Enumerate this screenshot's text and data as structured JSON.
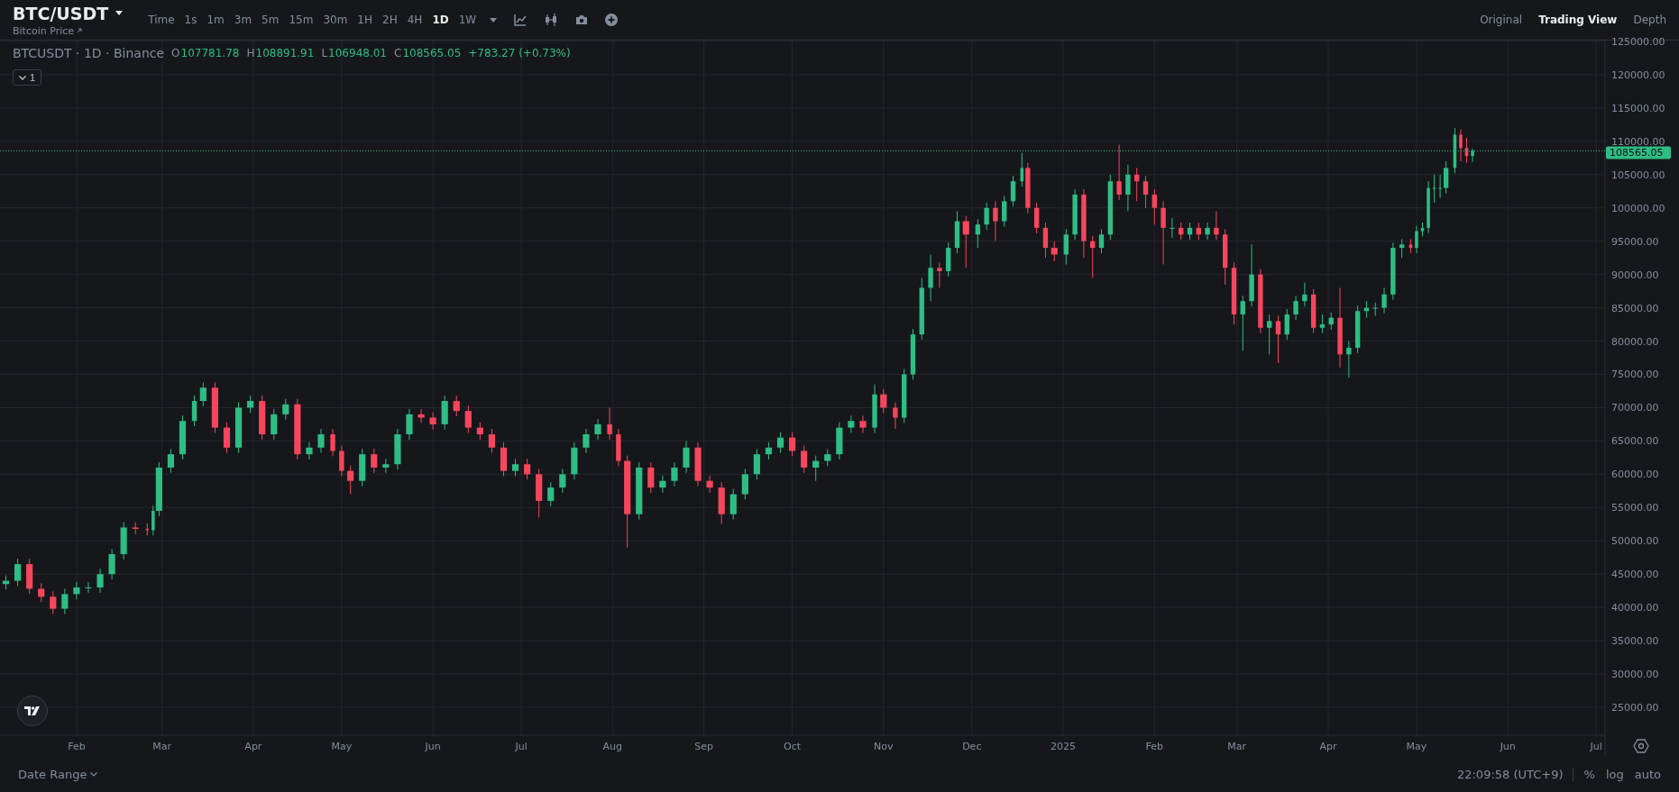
{
  "header": {
    "title": "BTC/USDT",
    "subtitle": "Bitcoin Price",
    "intervals": [
      {
        "label": "Time",
        "selected": false
      },
      {
        "label": "1s",
        "selected": false
      },
      {
        "label": "1m",
        "selected": false
      },
      {
        "label": "3m",
        "selected": false
      },
      {
        "label": "5m",
        "selected": false
      },
      {
        "label": "15m",
        "selected": false
      },
      {
        "label": "30m",
        "selected": false
      },
      {
        "label": "1H",
        "selected": false
      },
      {
        "label": "2H",
        "selected": false
      },
      {
        "label": "4H",
        "selected": false
      },
      {
        "label": "1D",
        "selected": true
      },
      {
        "label": "1W",
        "selected": false
      }
    ],
    "views": [
      {
        "label": "Original",
        "selected": false
      },
      {
        "label": "Trading View",
        "selected": true
      },
      {
        "label": "Depth",
        "selected": false
      }
    ]
  },
  "legend": {
    "symbol": "BTCUSDT · 1D · Binance",
    "ohlc": [
      {
        "label": "O",
        "value": "107781.78"
      },
      {
        "label": "H",
        "value": "108891.91"
      },
      {
        "label": "L",
        "value": "106948.01"
      },
      {
        "label": "C",
        "value": "108565.05"
      }
    ],
    "change": "+783.27 (+0.73%)",
    "collapse": "1"
  },
  "chart": {
    "last_price": "108565.05",
    "chart_data": {
      "type": "candlestick",
      "grid": true,
      "ref_lines": [
        {
          "axis": "y",
          "value": 108565,
          "color": "#2ebd85"
        }
      ],
      "xlim": [
        "2024-01-06",
        "2025-07-04"
      ],
      "ylim": [
        20800,
        125135
      ],
      "yticks": [
        {
          "value": 25000,
          "label": "25000.00"
        },
        {
          "value": 30000,
          "label": "30000.00"
        },
        {
          "value": 35000,
          "label": "35000.00"
        },
        {
          "value": 40000,
          "label": "40000.00"
        },
        {
          "value": 45000,
          "label": "45000.00"
        },
        {
          "value": 50000,
          "label": "50000.00"
        },
        {
          "value": 55000,
          "label": "55000.00"
        },
        {
          "value": 60000,
          "label": "60000.00"
        },
        {
          "value": 65000,
          "label": "65000.00"
        },
        {
          "value": 70000,
          "label": "70000.00"
        },
        {
          "value": 75000,
          "label": "75000.00"
        },
        {
          "value": 80000,
          "label": "80000.00"
        },
        {
          "value": 85000,
          "label": "85000.00"
        },
        {
          "value": 90000,
          "label": "90000.00"
        },
        {
          "value": 95000,
          "label": "95000.00"
        },
        {
          "value": 100000,
          "label": "100000.00"
        },
        {
          "value": 105000,
          "label": "105000.00"
        },
        {
          "value": 110000,
          "label": "110000.00"
        },
        {
          "value": 115000,
          "label": "115000.00"
        },
        {
          "value": 120000,
          "label": "120000.00"
        },
        {
          "value": 125000,
          "label": "125000.00"
        }
      ],
      "xticks": [
        {
          "value": "2024-02-01",
          "label": "Feb"
        },
        {
          "value": "2024-03-01",
          "label": "Mar"
        },
        {
          "value": "2024-04-01",
          "label": "Apr"
        },
        {
          "value": "2024-05-01",
          "label": "May"
        },
        {
          "value": "2024-06-01",
          "label": "Jun"
        },
        {
          "value": "2024-07-01",
          "label": "Jul"
        },
        {
          "value": "2024-08-01",
          "label": "Aug"
        },
        {
          "value": "2024-09-01",
          "label": "Sep"
        },
        {
          "value": "2024-10-01",
          "label": "Oct"
        },
        {
          "value": "2024-11-01",
          "label": "Nov"
        },
        {
          "value": "2024-12-01",
          "label": "Dec"
        },
        {
          "value": "2025-01-01",
          "label": "2025"
        },
        {
          "value": "2025-02-01",
          "label": "Feb"
        },
        {
          "value": "2025-03-01",
          "label": "Mar"
        },
        {
          "value": "2025-04-01",
          "label": "Apr"
        },
        {
          "value": "2025-05-01",
          "label": "May"
        },
        {
          "value": "2025-06-01",
          "label": "Jun"
        },
        {
          "value": "2025-07-01",
          "label": "Jul"
        }
      ],
      "x": [
        "2024-01-08",
        "2024-01-12",
        "2024-01-16",
        "2024-01-20",
        "2024-01-24",
        "2024-01-28",
        "2024-02-01",
        "2024-02-05",
        "2024-02-09",
        "2024-02-13",
        "2024-02-17",
        "2024-02-21",
        "2024-02-25",
        "2024-02-27",
        "2024-02-29",
        "2024-03-04",
        "2024-03-08",
        "2024-03-12",
        "2024-03-15",
        "2024-03-19",
        "2024-03-23",
        "2024-03-27",
        "2024-03-31",
        "2024-04-04",
        "2024-04-08",
        "2024-04-12",
        "2024-04-16",
        "2024-04-20",
        "2024-04-24",
        "2024-04-28",
        "2024-05-01",
        "2024-05-04",
        "2024-05-08",
        "2024-05-12",
        "2024-05-16",
        "2024-05-20",
        "2024-05-24",
        "2024-05-28",
        "2024-06-01",
        "2024-06-05",
        "2024-06-09",
        "2024-06-13",
        "2024-06-17",
        "2024-06-21",
        "2024-06-25",
        "2024-06-29",
        "2024-07-03",
        "2024-07-07",
        "2024-07-11",
        "2024-07-15",
        "2024-07-19",
        "2024-07-23",
        "2024-07-27",
        "2024-07-31",
        "2024-08-03",
        "2024-08-06",
        "2024-08-10",
        "2024-08-14",
        "2024-08-18",
        "2024-08-22",
        "2024-08-26",
        "2024-08-30",
        "2024-09-03",
        "2024-09-07",
        "2024-09-11",
        "2024-09-15",
        "2024-09-19",
        "2024-09-23",
        "2024-09-27",
        "2024-10-01",
        "2024-10-05",
        "2024-10-09",
        "2024-10-13",
        "2024-10-17",
        "2024-10-21",
        "2024-10-25",
        "2024-10-29",
        "2024-11-01",
        "2024-11-05",
        "2024-11-08",
        "2024-11-11",
        "2024-11-14",
        "2024-11-17",
        "2024-11-20",
        "2024-11-23",
        "2024-11-26",
        "2024-11-29",
        "2024-12-03",
        "2024-12-06",
        "2024-12-09",
        "2024-12-12",
        "2024-12-15",
        "2024-12-18",
        "2024-12-20",
        "2024-12-23",
        "2024-12-26",
        "2024-12-29",
        "2025-01-02",
        "2025-01-05",
        "2025-01-08",
        "2025-01-11",
        "2025-01-14",
        "2025-01-17",
        "2025-01-20",
        "2025-01-23",
        "2025-01-26",
        "2025-01-29",
        "2025-02-01",
        "2025-02-04",
        "2025-02-07",
        "2025-02-10",
        "2025-02-13",
        "2025-02-16",
        "2025-02-19",
        "2025-02-22",
        "2025-02-25",
        "2025-02-28",
        "2025-03-03",
        "2025-03-06",
        "2025-03-09",
        "2025-03-12",
        "2025-03-15",
        "2025-03-18",
        "2025-03-21",
        "2025-03-24",
        "2025-03-27",
        "2025-03-30",
        "2025-04-02",
        "2025-04-05",
        "2025-04-08",
        "2025-04-11",
        "2025-04-14",
        "2025-04-17",
        "2025-04-20",
        "2025-04-23",
        "2025-04-26",
        "2025-04-29",
        "2025-05-01",
        "2025-05-03",
        "2025-05-05",
        "2025-05-07",
        "2025-05-09",
        "2025-05-11",
        "2025-05-14",
        "2025-05-16",
        "2025-05-18",
        "2025-05-20"
      ],
      "ohlc": [
        [
          43500,
          44800,
          42700,
          44000
        ],
        [
          44000,
          47300,
          43200,
          46500
        ],
        [
          46500,
          47300,
          42000,
          42800
        ],
        [
          42800,
          43600,
          40800,
          41600
        ],
        [
          41600,
          42400,
          39000,
          39800
        ],
        [
          39800,
          42800,
          39000,
          42000
        ],
        [
          42000,
          43800,
          41200,
          43000
        ],
        [
          43000,
          43800,
          42200,
          43000
        ],
        [
          43000,
          45800,
          42200,
          45000
        ],
        [
          45000,
          48800,
          44200,
          48000
        ],
        [
          48000,
          52800,
          47200,
          52000
        ],
        [
          52000,
          52800,
          51000,
          51800
        ],
        [
          51800,
          52600,
          50800,
          51600
        ],
        [
          51600,
          55300,
          50800,
          54500
        ],
        [
          54500,
          61800,
          53700,
          61000
        ],
        [
          61000,
          63800,
          60200,
          63000
        ],
        [
          63000,
          68800,
          62200,
          68000
        ],
        [
          68000,
          71800,
          67200,
          71000
        ],
        [
          71000,
          73800,
          70200,
          73000
        ],
        [
          73000,
          73800,
          66200,
          67000
        ],
        [
          67000,
          67800,
          63200,
          64000
        ],
        [
          64000,
          70800,
          63200,
          70000
        ],
        [
          70000,
          71800,
          69200,
          71000
        ],
        [
          71000,
          71800,
          65200,
          66000
        ],
        [
          66000,
          69800,
          65200,
          69000
        ],
        [
          69000,
          71300,
          68200,
          70500
        ],
        [
          70500,
          71300,
          62200,
          63000
        ],
        [
          63000,
          64800,
          62200,
          64000
        ],
        [
          64000,
          66800,
          63200,
          66000
        ],
        [
          66000,
          66800,
          62700,
          63500
        ],
        [
          63500,
          64300,
          59700,
          60500
        ],
        [
          60500,
          61300,
          57000,
          59000
        ],
        [
          59000,
          63800,
          58200,
          63000
        ],
        [
          63000,
          63800,
          60200,
          61000
        ],
        [
          61000,
          62300,
          60200,
          61500
        ],
        [
          61500,
          66800,
          60700,
          66000
        ],
        [
          66000,
          69800,
          65200,
          69000
        ],
        [
          69000,
          69800,
          67700,
          68500
        ],
        [
          68500,
          69300,
          66700,
          67500
        ],
        [
          67500,
          71800,
          66700,
          71000
        ],
        [
          71000,
          71800,
          68700,
          69500
        ],
        [
          69500,
          70300,
          66200,
          67000
        ],
        [
          67000,
          67800,
          65200,
          66000
        ],
        [
          66000,
          66800,
          63200,
          64000
        ],
        [
          64000,
          64800,
          59700,
          60500
        ],
        [
          60500,
          62300,
          59700,
          61500
        ],
        [
          61500,
          62300,
          59200,
          60000
        ],
        [
          60000,
          60800,
          53500,
          56000
        ],
        [
          56000,
          58800,
          55200,
          58000
        ],
        [
          58000,
          60800,
          57200,
          60000
        ],
        [
          60000,
          64800,
          59200,
          64000
        ],
        [
          64000,
          66800,
          63200,
          66000
        ],
        [
          66000,
          68300,
          65200,
          67500
        ],
        [
          67500,
          70000,
          65200,
          66000
        ],
        [
          66000,
          66800,
          61200,
          62000
        ],
        [
          62000,
          62800,
          49000,
          54000
        ],
        [
          54000,
          61800,
          53200,
          61000
        ],
        [
          61000,
          61800,
          57200,
          58000
        ],
        [
          58000,
          59800,
          57200,
          59000
        ],
        [
          59000,
          61800,
          58200,
          61000
        ],
        [
          61000,
          65000,
          60200,
          64000
        ],
        [
          64000,
          64800,
          58200,
          59000
        ],
        [
          59000,
          59800,
          57200,
          58000
        ],
        [
          58000,
          58800,
          52500,
          54000
        ],
        [
          54000,
          57800,
          53200,
          57000
        ],
        [
          57000,
          60800,
          56200,
          60000
        ],
        [
          60000,
          63800,
          59200,
          63000
        ],
        [
          63000,
          64800,
          62200,
          64000
        ],
        [
          64000,
          66300,
          63200,
          65500
        ],
        [
          65500,
          66300,
          62700,
          63500
        ],
        [
          63500,
          64300,
          60200,
          61000
        ],
        [
          61000,
          62800,
          59000,
          62000
        ],
        [
          62000,
          63800,
          61200,
          63000
        ],
        [
          63000,
          67800,
          62200,
          67000
        ],
        [
          67000,
          68800,
          66200,
          68000
        ],
        [
          68000,
          68800,
          66200,
          67000
        ],
        [
          67000,
          73500,
          66200,
          72000
        ],
        [
          72000,
          72800,
          69200,
          70000
        ],
        [
          70000,
          70800,
          66800,
          68500
        ],
        [
          68500,
          75800,
          67700,
          75000
        ],
        [
          75000,
          81800,
          74200,
          81000
        ],
        [
          81000,
          89500,
          80200,
          88000
        ],
        [
          88000,
          93000,
          86000,
          91000
        ],
        [
          91000,
          91800,
          88000,
          90500
        ],
        [
          90500,
          94800,
          89700,
          94000
        ],
        [
          94000,
          99500,
          93200,
          98000
        ],
        [
          98000,
          98800,
          91000,
          96000
        ],
        [
          96000,
          98300,
          94000,
          97500
        ],
        [
          97500,
          100800,
          96700,
          100000
        ],
        [
          100000,
          101000,
          95000,
          98000
        ],
        [
          98000,
          101800,
          97200,
          101000
        ],
        [
          101000,
          104800,
          100200,
          104000
        ],
        [
          104000,
          108300,
          103200,
          106000
        ],
        [
          106000,
          106800,
          99200,
          100000
        ],
        [
          100000,
          100800,
          96200,
          97000
        ],
        [
          97000,
          97800,
          92500,
          94000
        ],
        [
          94000,
          95000,
          92000,
          93000
        ],
        [
          93000,
          96800,
          91500,
          96000
        ],
        [
          96000,
          102800,
          95200,
          102000
        ],
        [
          102000,
          102800,
          92500,
          95000
        ],
        [
          95000,
          95800,
          89500,
          94000
        ],
        [
          94000,
          96800,
          93200,
          96000
        ],
        [
          96000,
          105000,
          95200,
          104000
        ],
        [
          104000,
          109500,
          101200,
          102000
        ],
        [
          102000,
          106500,
          99500,
          105000
        ],
        [
          105000,
          106000,
          101000,
          104000
        ],
        [
          104000,
          104800,
          100000,
          102000
        ],
        [
          102000,
          102800,
          97500,
          100000
        ],
        [
          100000,
          101000,
          91500,
          97000
        ],
        [
          97000,
          98500,
          95500,
          97000
        ],
        [
          97000,
          97800,
          95200,
          96000
        ],
        [
          96000,
          97800,
          95200,
          97000
        ],
        [
          97000,
          97800,
          95200,
          96000
        ],
        [
          96000,
          97800,
          95200,
          97000
        ],
        [
          97000,
          99500,
          95200,
          96000
        ],
        [
          96000,
          96800,
          88500,
          91000
        ],
        [
          91000,
          91800,
          82500,
          84000
        ],
        [
          84000,
          86800,
          78500,
          86000
        ],
        [
          86000,
          94500,
          85200,
          90000
        ],
        [
          90000,
          90800,
          81200,
          82000
        ],
        [
          82000,
          84000,
          78000,
          83000
        ],
        [
          83000,
          83800,
          76700,
          81000
        ],
        [
          81000,
          84800,
          80200,
          84000
        ],
        [
          84000,
          86800,
          83200,
          86000
        ],
        [
          86000,
          88800,
          85200,
          87000
        ],
        [
          87000,
          87800,
          81200,
          82000
        ],
        [
          82000,
          84000,
          81200,
          82500
        ],
        [
          82500,
          84300,
          81700,
          83500
        ],
        [
          83500,
          88000,
          76000,
          78000
        ],
        [
          78000,
          80000,
          74500,
          79000
        ],
        [
          79000,
          85300,
          78200,
          84500
        ],
        [
          84500,
          86000,
          83500,
          85000
        ],
        [
          85000,
          85800,
          83800,
          85000
        ],
        [
          85000,
          88000,
          84200,
          87000
        ],
        [
          87000,
          94800,
          86200,
          94000
        ],
        [
          94000,
          95300,
          92500,
          94500
        ],
        [
          94500,
          95300,
          93200,
          94000
        ],
        [
          94000,
          97300,
          93200,
          96500
        ],
        [
          96500,
          97800,
          95700,
          97000
        ],
        [
          97000,
          104000,
          96200,
          103000
        ],
        [
          103000,
          105000,
          100800,
          103000
        ],
        [
          103000,
          105000,
          101500,
          103000
        ],
        [
          103000,
          107000,
          102200,
          106000
        ],
        [
          106000,
          112000,
          105200,
          111000
        ],
        [
          111000,
          111800,
          107000,
          109000
        ],
        [
          109000,
          110500,
          106800,
          107800
        ],
        [
          107800,
          108900,
          106900,
          108600
        ]
      ]
    }
  },
  "footer": {
    "date_range": "Date Range",
    "clock": "22:09:58 (UTC+9)",
    "scale_options": [
      "%",
      "log",
      "auto"
    ]
  }
}
